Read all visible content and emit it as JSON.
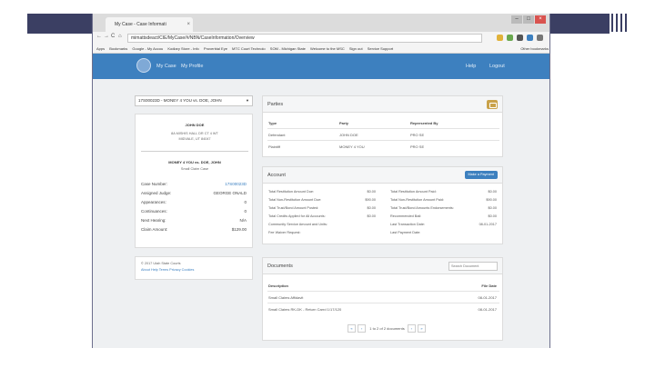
{
  "browser": {
    "tab_title": "My Case - Case Informati",
    "tab_close": "×",
    "window_controls": [
      "–",
      "□",
      "×"
    ],
    "nav_back": "←",
    "nav_forward": "→",
    "nav_reload": "C",
    "nav_home": "⌂",
    "url": "mimattsdeact/CIE/MyCase/#/NBN/CaseInformation/Overview",
    "bookmarks": [
      "Apps",
      "Bookmarks",
      "Google - My Accou",
      "Kodiary Store - Info",
      "Proverbial Eye",
      "MTC Court Technolo",
      "SOM - Michigan State",
      "Welcome to the MSC",
      "Sign out",
      "Service Support"
    ],
    "other_bookmarks": "Other bookmarks"
  },
  "appnav": {
    "my_case": "My Case",
    "my_profile": "My Profile",
    "help": "Help",
    "logout": "Logout"
  },
  "case_selector": {
    "value": "17S00023D - MONEY 4 YOU vs. DOE, JOHN"
  },
  "left_card": {
    "party_name": "JOHN DOE",
    "address_line1": "8A MISHIS HALL DR CT 4 WT",
    "address_line2": "MIDVALE, UT 84047",
    "case_title": "MONEY 4 YOU vs. DOE, JOHN",
    "case_type": "Small Claim Case",
    "fields": [
      {
        "label": "Case Number:",
        "value": "17S00023D",
        "link": true
      },
      {
        "label": "Assigned Judge:",
        "value": "GEORGE ONALD",
        "link": false
      },
      {
        "label": "Appearances:",
        "value": "0",
        "link": false
      },
      {
        "label": "Continuances:",
        "value": "0",
        "link": false
      },
      {
        "label": "Next Hearing:",
        "value": "N/A",
        "link": false
      },
      {
        "label": "Claim Amount:",
        "value": "$129.00",
        "link": false
      }
    ]
  },
  "footer": {
    "copyright": "© 2017 Utah State Courts",
    "links": "About   Help   Terms   Privacy   Cookies"
  },
  "parties": {
    "title": "Parties",
    "headers": [
      "Type",
      "Party",
      "Represented By"
    ],
    "rows": [
      [
        "Defendant",
        "JOHN DOE",
        "PRO SE"
      ],
      [
        "Plaintiff",
        "MONEY 4 YOU",
        "PRO SE"
      ]
    ]
  },
  "account": {
    "title": "Account",
    "make_payment": "Make a Payment",
    "left": [
      {
        "label": "Total Restitution Amount Due:",
        "value": "$0.00"
      },
      {
        "label": "Total Non-Restitution Amount Due:",
        "value": "$90.00"
      },
      {
        "label": "Total Trust/Bond Amount Posted:",
        "value": "$0.00"
      },
      {
        "label": "Total Credits Applied for All Accounts:",
        "value": "$0.00"
      },
      {
        "label": "Community Service Amount and Units:",
        "value": ""
      },
      {
        "label": "Fee Waiver Request:",
        "value": ""
      }
    ],
    "right": [
      {
        "label": "Total Restitution Amount Paid:",
        "value": "$0.00"
      },
      {
        "label": "Total Non-Restitution Amount Paid:",
        "value": "$90.00"
      },
      {
        "label": "Total Trust/Bond Amounts Endorsements:",
        "value": "$0.00"
      },
      {
        "label": "Recommended Bail:",
        "value": "$0.00"
      },
      {
        "label": "Last Transaction Date:",
        "value": "08-01-2017"
      },
      {
        "label": "Last Payment Date:",
        "value": ""
      }
    ]
  },
  "documents": {
    "title": "Documents",
    "search_placeholder": "Search Document",
    "headers": [
      "Description",
      "File Date"
    ],
    "rows": [
      [
        "Small Claims Affidavit",
        "08-01-2017"
      ],
      [
        "Small Claims RK-DK - Return Carrd 1/17/120",
        "08-01-2017"
      ]
    ],
    "pager_text": "1 to 2 of 2 documents",
    "pager_first": "«",
    "pager_prev": "‹",
    "pager_next": "›",
    "pager_last": "»"
  },
  "colors": {
    "nav_blue": "#3d80bf",
    "slide_bar": "#3b3f63",
    "gold_button": "#c9a24a"
  }
}
